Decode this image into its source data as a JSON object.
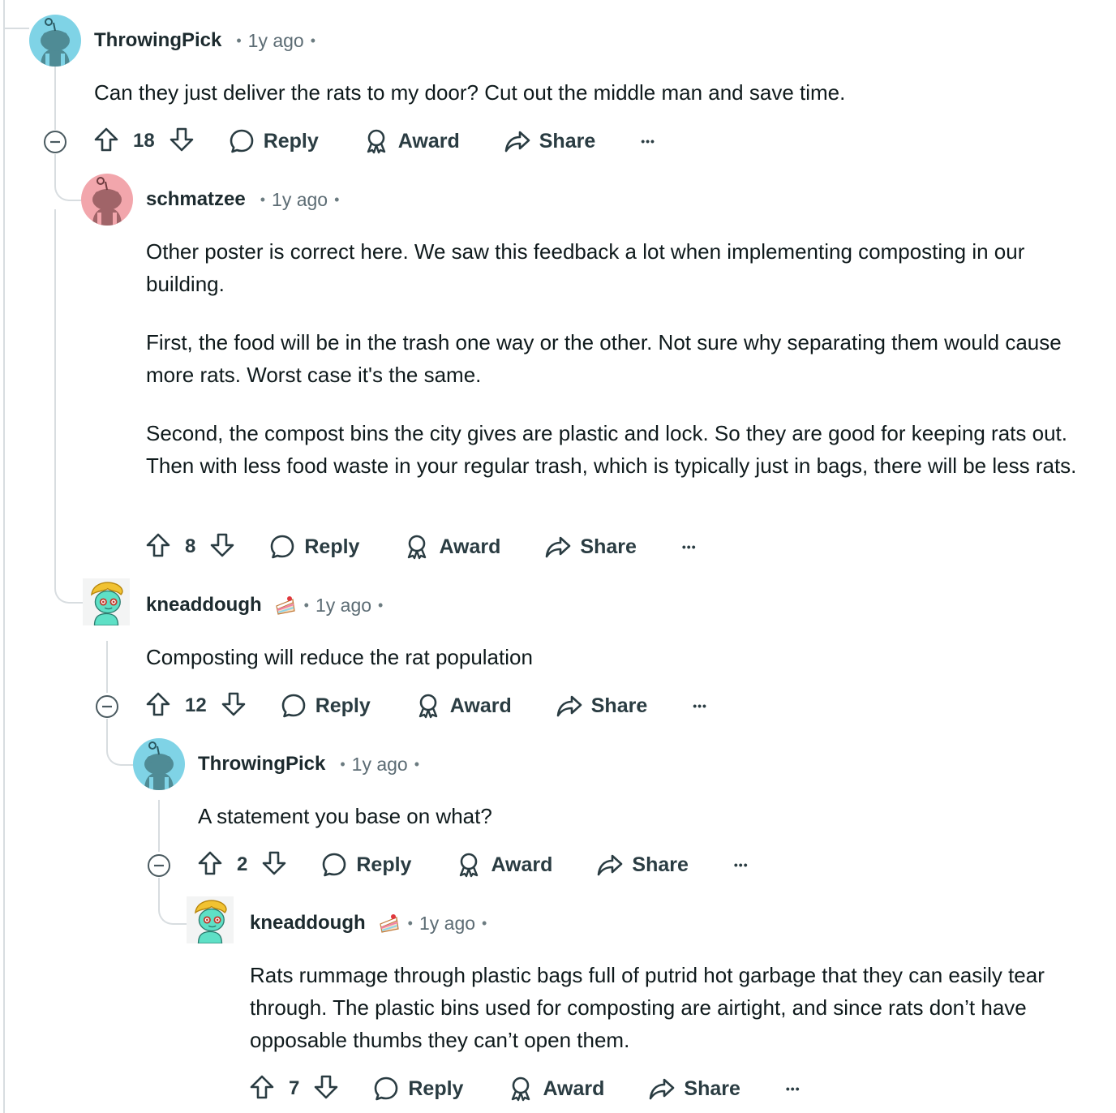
{
  "labels": {
    "reply": "Reply",
    "award": "Award",
    "share": "Share",
    "more": "•••"
  },
  "comments": [
    {
      "author": "ThrowingPick",
      "time": "1y ago",
      "avatar": "snoo-default-blue",
      "paragraphs": [
        "Can they just deliver the rats to my door? Cut out the middle man and save time."
      ],
      "votes": "18"
    },
    {
      "author": "schmatzee",
      "time": "1y ago",
      "avatar": "snoo-default-red",
      "paragraphs": [
        "Other poster is correct here. We saw this feedback a lot when implementing composting in our building.",
        "First, the food will be in the trash one way or the other. Not sure why separating them would cause more rats. Worst case it's the same.",
        "Second, the compost bins the city gives are plastic and lock. So they are good for keeping rats out. Then with less food waste in your regular trash, which is typically just in bags, there will be less rats."
      ],
      "votes": "8"
    },
    {
      "author": "kneaddough",
      "time": "1y ago",
      "avatar": "snoo-custom-blond",
      "flair": "cake-icon",
      "paragraphs": [
        "Composting will reduce the rat population"
      ],
      "votes": "12"
    },
    {
      "author": "ThrowingPick",
      "time": "1y ago",
      "avatar": "snoo-default-blue",
      "paragraphs": [
        "A statement you base on what?"
      ],
      "votes": "2"
    },
    {
      "author": "kneaddough",
      "time": "1y ago",
      "avatar": "snoo-custom-blond",
      "flair": "cake-icon",
      "paragraphs": [
        "Rats rummage through plastic bags full of putrid hot garbage that they can easily tear through. The plastic bins used for composting are airtight, and since rats don’t have opposable thumbs they can’t open them."
      ],
      "votes": "7"
    }
  ],
  "colors": {
    "text": "#0f1a1c",
    "meta": "#5c6c74",
    "thread_line": "#d8dde0",
    "avatar_blue": "#7fd3e6",
    "avatar_red": "#f2a6ac",
    "avatar_custom_skin": "#5ee0c6"
  }
}
